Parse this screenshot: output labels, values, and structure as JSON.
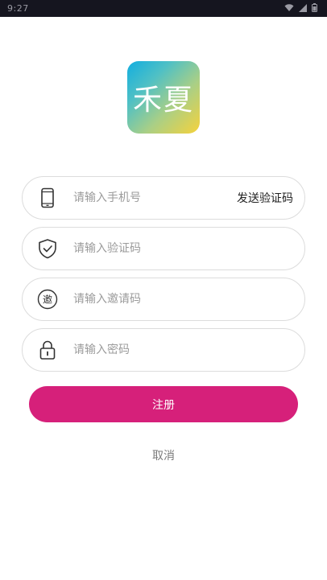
{
  "status_bar": {
    "time": "9:27"
  },
  "logo": {
    "text": "禾夏"
  },
  "form": {
    "phone": {
      "placeholder": "请输入手机号",
      "value": ""
    },
    "send_code_label": "发送验证码",
    "verify_code": {
      "placeholder": "请输入验证码",
      "value": ""
    },
    "invite_code": {
      "placeholder": "请输入邀请码",
      "value": "",
      "icon_glyph": "邀"
    },
    "password": {
      "placeholder": "请输入密码",
      "value": ""
    }
  },
  "register_label": "注册",
  "cancel_label": "取消",
  "icons": {
    "phone": "phone-icon",
    "verify": "shield-check-icon",
    "invite": "invite-icon",
    "password": "lock-icon"
  },
  "colors": {
    "primary": "#d6207a",
    "statusbar_bg": "#15151f",
    "logo_gradient": [
      "#11aee0",
      "#f6d23b"
    ]
  }
}
